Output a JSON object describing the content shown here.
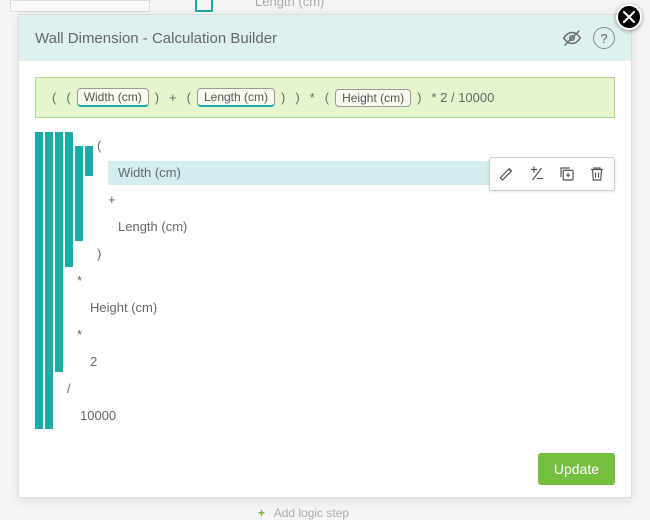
{
  "modal": {
    "title": "Wall Dimension - Calculation Builder"
  },
  "formula": {
    "chips": {
      "width": "Width (cm)",
      "length": "Length (cm)",
      "height": "Height (cm)"
    },
    "ops": {
      "lp": "(",
      "rp": ")",
      "plus": "+",
      "star": "*",
      "slash": "/"
    },
    "trail": "* 2 / 10000"
  },
  "tree": {
    "r0": "(",
    "r1": "Width (cm)",
    "r2": "+",
    "r3": "Length (cm)",
    "r4": ")",
    "r5": "*",
    "r6": "Height (cm)",
    "r7": "*",
    "r8": "2",
    "r9": "/",
    "r10": "10000"
  },
  "buttons": {
    "update": "Update"
  },
  "bg": {
    "top_text": "Length (cm)",
    "add_step": "Add logic step"
  }
}
